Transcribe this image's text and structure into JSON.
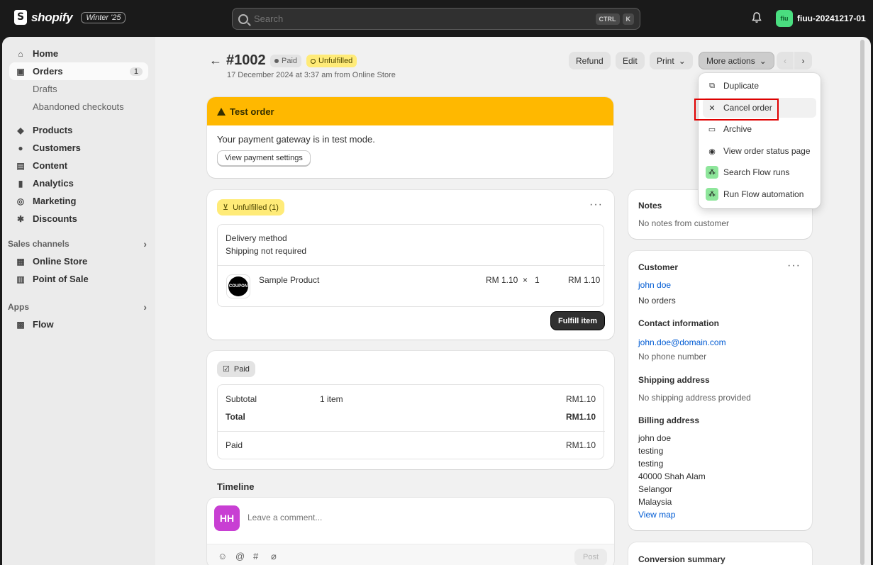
{
  "topbar": {
    "brand": "shopify",
    "release_badge": "Winter '25",
    "search_placeholder": "Search",
    "kbd_ctrl": "CTRL",
    "kbd_k": "K",
    "store_name": "fiuu-20241217-01",
    "avatar_initials": "fiu"
  },
  "sidebar": {
    "items": [
      {
        "label": "Home",
        "icon": "home-icon"
      },
      {
        "label": "Orders",
        "icon": "orders-icon",
        "count": "1"
      },
      {
        "label": "Drafts"
      },
      {
        "label": "Abandoned checkouts"
      },
      {
        "label": "Products",
        "icon": "tag-icon"
      },
      {
        "label": "Customers",
        "icon": "person-icon"
      },
      {
        "label": "Content",
        "icon": "image-icon"
      },
      {
        "label": "Analytics",
        "icon": "bar-chart-icon"
      },
      {
        "label": "Marketing",
        "icon": "target-icon"
      },
      {
        "label": "Discounts",
        "icon": "discount-icon"
      }
    ],
    "sales_channels_label": "Sales channels",
    "channels": [
      {
        "label": "Online Store",
        "icon": "store-icon"
      },
      {
        "label": "Point of Sale",
        "icon": "pos-icon"
      }
    ],
    "apps_label": "Apps",
    "apps": [
      {
        "label": "Flow",
        "icon": "flow-icon"
      }
    ]
  },
  "order": {
    "title": "#1002",
    "paid_badge": "Paid",
    "unfulfilled_badge": "Unfulfilled",
    "subtitle": "17 December 2024 at 3:37 am from Online Store"
  },
  "actions": {
    "refund": "Refund",
    "edit": "Edit",
    "print": "Print",
    "more": "More actions"
  },
  "dropdown": {
    "items": [
      "Duplicate",
      "Cancel order",
      "Archive",
      "View order status page",
      "Search Flow runs",
      "Run Flow automation"
    ]
  },
  "test_order": {
    "title": "Test order",
    "message": "Your payment gateway is in test mode.",
    "button": "View payment settings"
  },
  "fulfillment": {
    "chip": "Unfulfilled (1)",
    "delivery_label": "Delivery method",
    "delivery_value": "Shipping not required",
    "product_name": "Sample Product",
    "product_img_text": "COUPON",
    "unit_price": "RM 1.10",
    "times": "×",
    "qty": "1",
    "line_total": "RM 1.10",
    "fulfill_button": "Fulfill item"
  },
  "payment": {
    "chip": "Paid",
    "subtotal_label": "Subtotal",
    "subtotal_items": "1 item",
    "subtotal_value": "RM1.10",
    "total_label": "Total",
    "total_value": "RM1.10",
    "paid_label": "Paid",
    "paid_value": "RM1.10"
  },
  "timeline": {
    "title": "Timeline",
    "avatar": "HH",
    "placeholder": "Leave a comment...",
    "post": "Post"
  },
  "notes": {
    "title": "Notes",
    "value": "No notes from customer"
  },
  "customer": {
    "title": "Customer",
    "name": "john doe",
    "orders": "No orders",
    "contact_title": "Contact information",
    "email": "john.doe@domain.com",
    "phone": "No phone number",
    "shipping_title": "Shipping address",
    "shipping_value": "No shipping address provided",
    "billing_title": "Billing address",
    "billing_lines": [
      "john doe",
      "testing",
      "testing",
      "40000 Shah Alam",
      "Selangor",
      "Malaysia"
    ],
    "view_map": "View map"
  },
  "conversion": {
    "title": "Conversion summary"
  }
}
